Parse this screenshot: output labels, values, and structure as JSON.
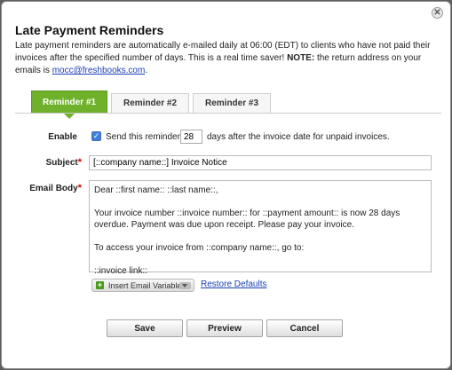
{
  "dialog": {
    "title": "Late Payment Reminders",
    "close_icon": "close-icon",
    "intro_text": "Late payment reminders are automatically e-mailed daily at 06:00 (EDT) to clients who have not paid their invoices after the specified number of days. This is a real time saver!",
    "note_label": "NOTE:",
    "note_text": "the return address on your emails is",
    "return_email": "mocc@freshbooks.com",
    "period": "."
  },
  "tabs": [
    {
      "label": "Reminder #1",
      "active": true
    },
    {
      "label": "Reminder #2",
      "active": false
    },
    {
      "label": "Reminder #3",
      "active": false
    }
  ],
  "form": {
    "enable_label": "Enable",
    "enable_checked": true,
    "send_text_before": "Send this reminder",
    "days_value": "28",
    "send_text_after": "days after the invoice date for unpaid invoices.",
    "subject_label": "Subject",
    "subject_value": "[::company name::] Invoice Notice",
    "required_mark": "*",
    "body_label": "Email Body",
    "body_value": "Dear ::first name:: ::last name::,\n\nYour invoice number ::invoice number:: for ::payment amount:: is now 28 days overdue. Payment was due upon receipt. Please pay your invoice.\n\nTo access your invoice from ::company name::, go to:\n\n::invoice link::",
    "insert_variable_label": "Insert Email Variable",
    "restore_defaults_label": "Restore Defaults"
  },
  "buttons": {
    "save": "Save",
    "preview": "Preview",
    "cancel": "Cancel"
  }
}
